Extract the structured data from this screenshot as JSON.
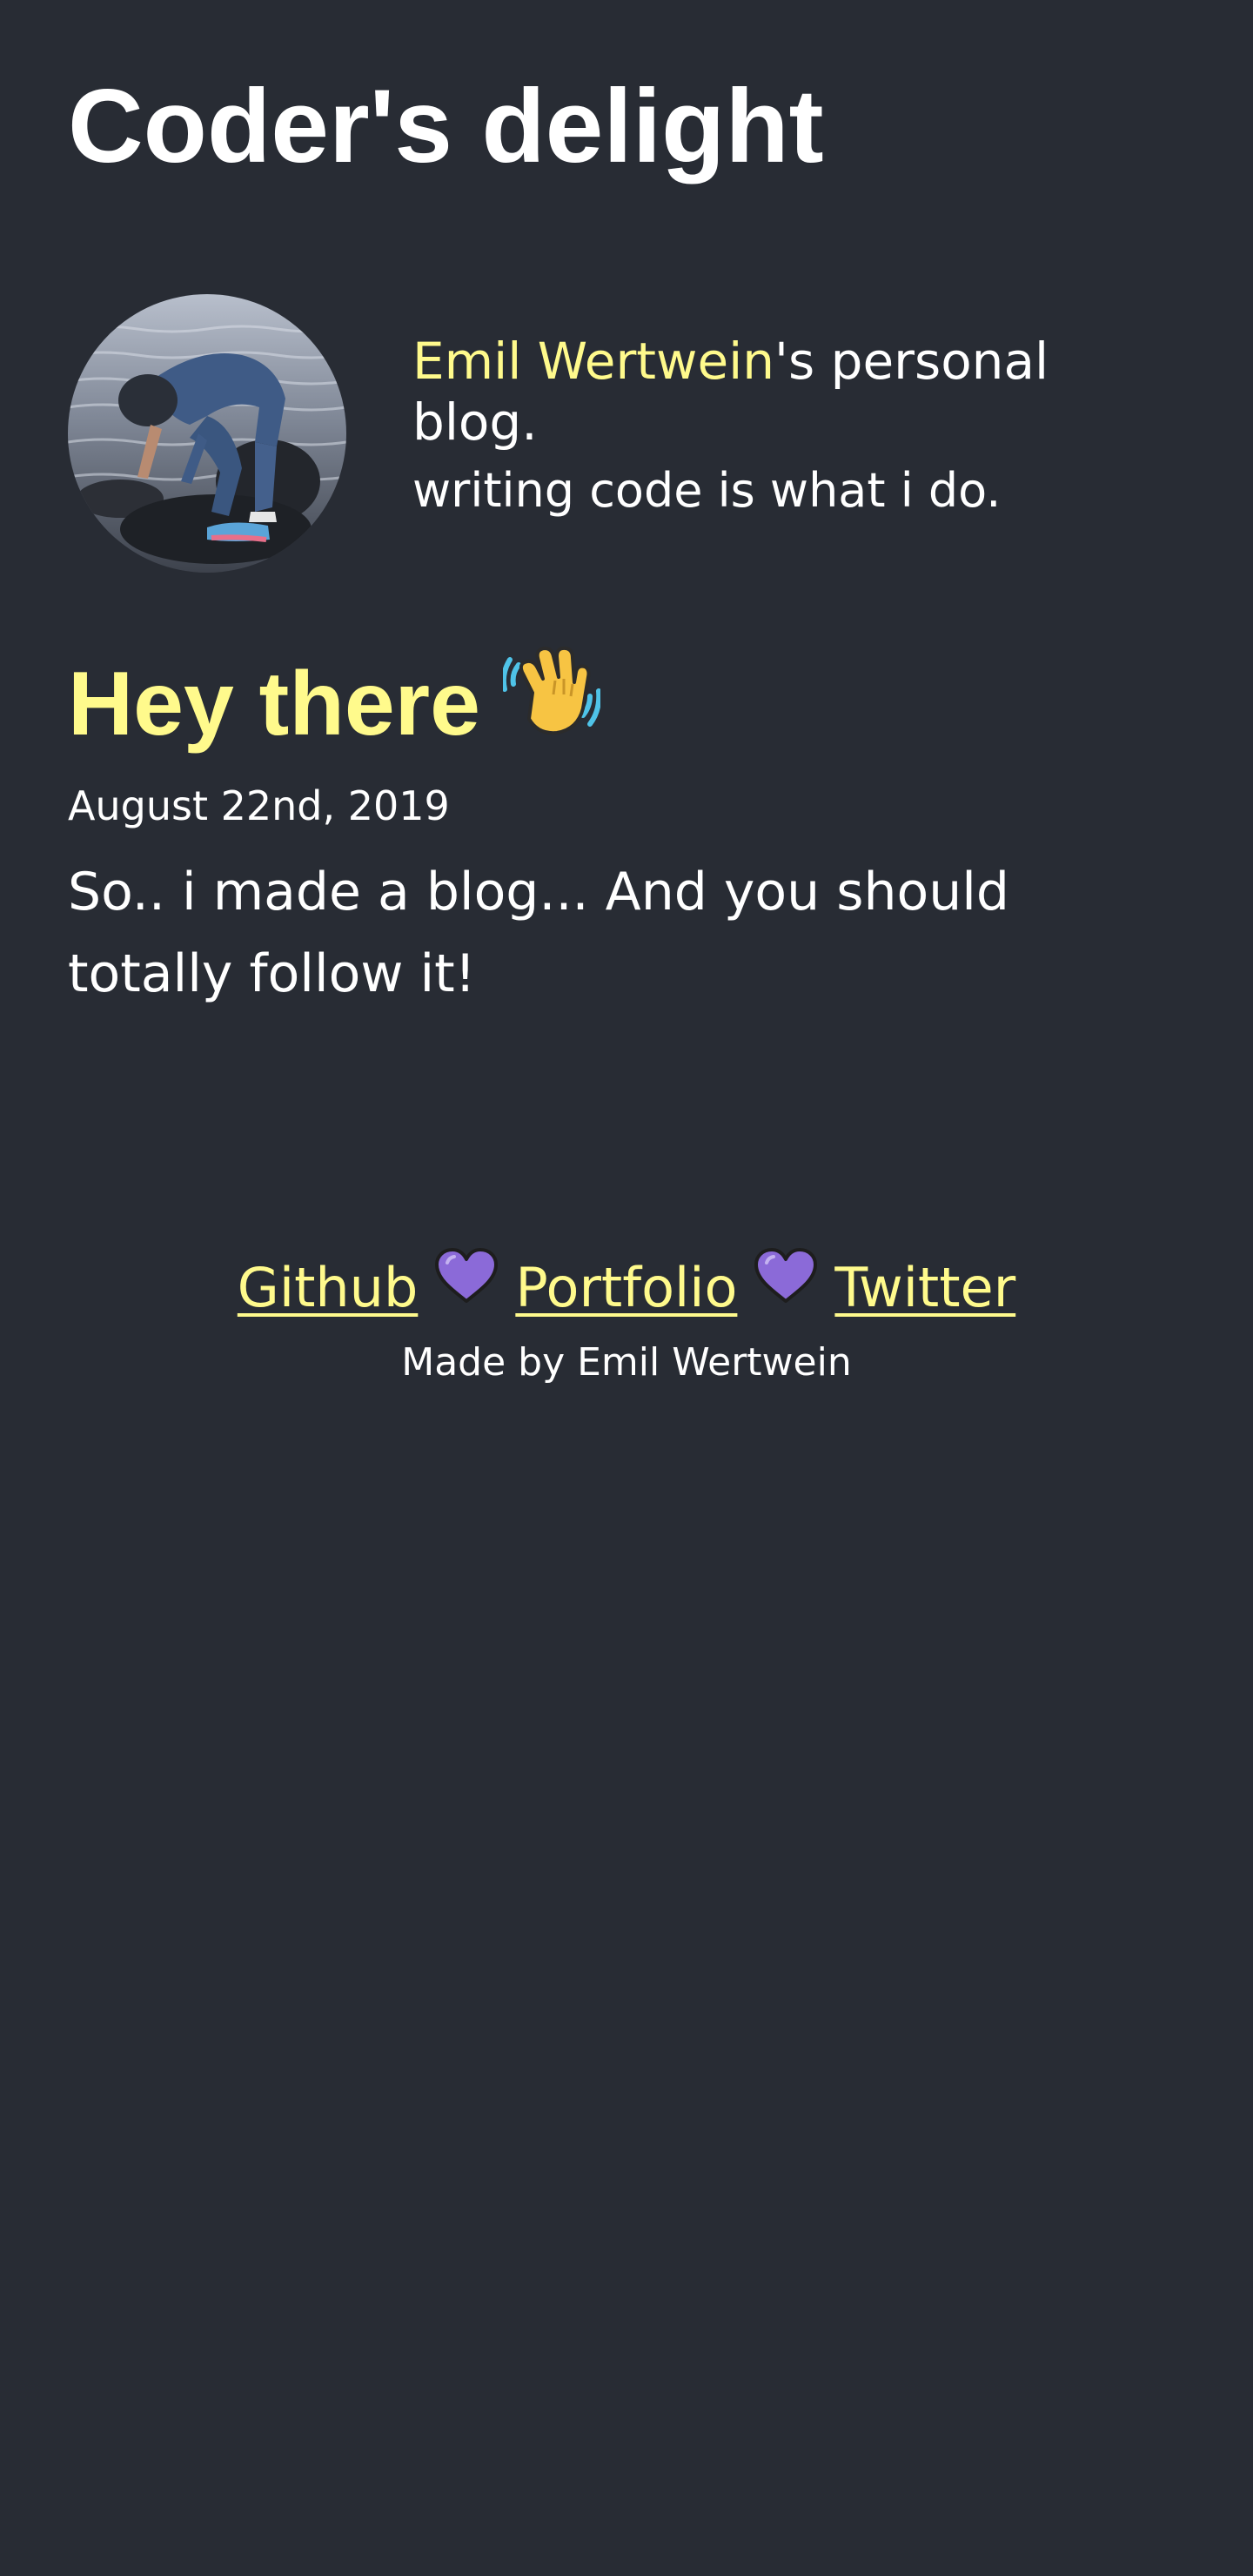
{
  "site": {
    "title": "Coder's delight"
  },
  "bio": {
    "author_name": "Emil Wertwein",
    "tagline_suffix": "'s personal blog.",
    "description": "writing code is what i do."
  },
  "post": {
    "title": "Hey there",
    "emoji_icon": "waving-hand-icon",
    "date": "August 22nd, 2019",
    "excerpt": "So.. i made a blog... And you should totally follow it!"
  },
  "footer": {
    "links": [
      {
        "label": "Github"
      },
      {
        "label": "Portfolio"
      },
      {
        "label": "Twitter"
      }
    ],
    "separator_icon": "purple-heart-icon",
    "credit": "Made by Emil Wertwein"
  },
  "colors": {
    "background": "#282c34",
    "accent": "#fffa8c",
    "heart": "#8b6ad8"
  }
}
